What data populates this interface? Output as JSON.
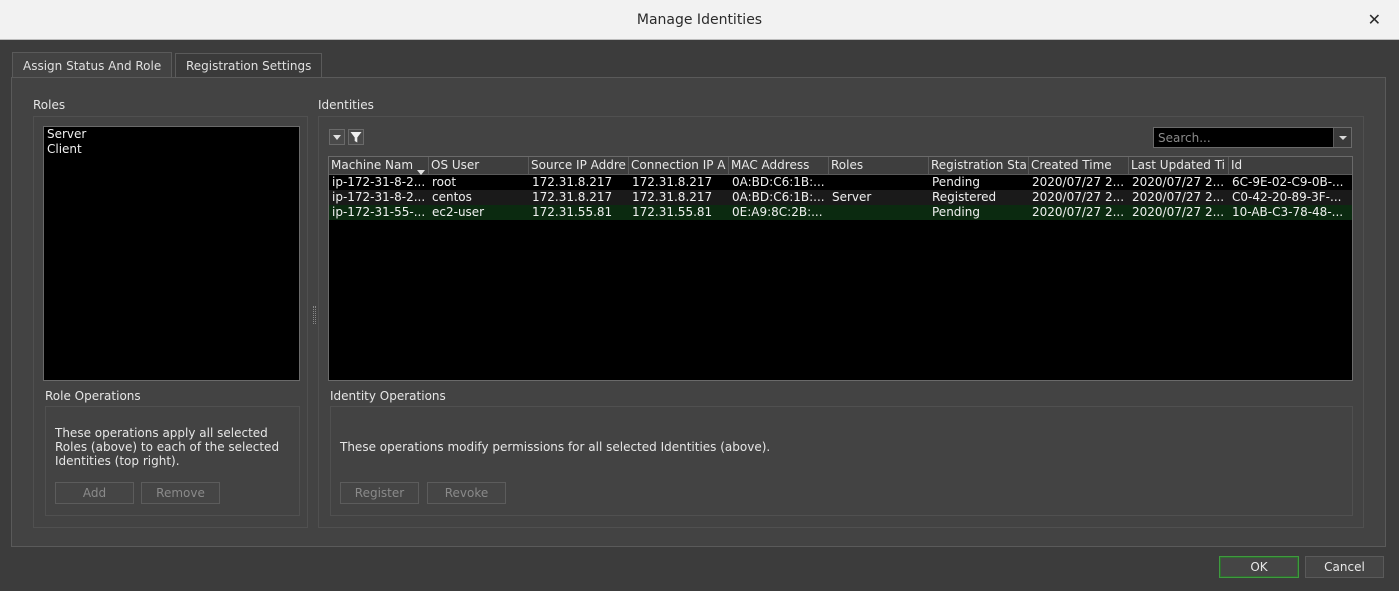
{
  "window": {
    "title": "Manage Identities",
    "close_glyph": "✕"
  },
  "tabs": [
    {
      "label": "Assign Status And Role",
      "active": true
    },
    {
      "label": "Registration Settings",
      "active": false
    }
  ],
  "roles": {
    "heading": "Roles",
    "items": [
      "Server",
      "Client"
    ],
    "operations_heading": "Role Operations",
    "operations_desc": "These operations apply all selected Roles (above) to each of the selected Identities (top right).",
    "add_label": "Add",
    "remove_label": "Remove"
  },
  "identities": {
    "heading": "Identities",
    "search_placeholder": "Search...",
    "columns": [
      "Machine Nam",
      "OS User",
      "Source IP Addre",
      "Connection IP A",
      "MAC Address",
      "Roles",
      "Registration Sta",
      "Created Time",
      "Last Updated Ti",
      "Id"
    ],
    "rows": [
      [
        "ip-172-31-8-2...",
        "root",
        "172.31.8.217",
        "172.31.8.217",
        "0A:BD:C6:1B:...",
        "",
        "Pending",
        "2020/07/27 2...",
        "2020/07/27 2...",
        "6C-9E-02-C9-0B-..."
      ],
      [
        "ip-172-31-8-2...",
        "centos",
        "172.31.8.217",
        "172.31.8.217",
        "0A:BD:C6:1B:...",
        "Server",
        "Registered",
        "2020/07/27 2...",
        "2020/07/27 2...",
        "C0-42-20-89-3F-..."
      ],
      [
        "ip-172-31-55-...",
        "ec2-user",
        "172.31.55.81",
        "172.31.55.81",
        "0E:A9:8C:2B:...",
        "",
        "Pending",
        "2020/07/27 2...",
        "2020/07/27 2...",
        "10-AB-C3-78-48-..."
      ]
    ],
    "operations_heading": "Identity Operations",
    "operations_desc": "These operations modify permissions for all selected Identities (above).",
    "register_label": "Register",
    "revoke_label": "Revoke"
  },
  "footer": {
    "ok_label": "OK",
    "cancel_label": "Cancel"
  },
  "colors": {
    "row_alt": "#1a1a1a",
    "row_selected": "#0b2a10",
    "ok_border": "#3f9a3f"
  }
}
